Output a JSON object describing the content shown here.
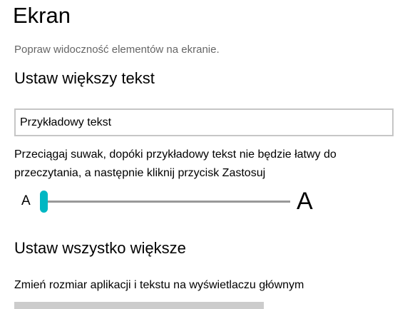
{
  "page": {
    "title": "Ekran",
    "subtitle": "Popraw widoczność elementów na ekranie."
  },
  "text_size": {
    "heading": "Ustaw większy tekst",
    "sample_value": "Przykładowy tekst",
    "description": "Przeciągaj suwak, dopóki przykładowy tekst nie będzie łatwy do przeczytania, a następnie kliknij przycisk Zastosuj",
    "small_label": "A",
    "large_label": "A",
    "slider_value_percent": 0,
    "accent": "#00b7c3"
  },
  "scale": {
    "heading": "Ustaw wszystko większe",
    "description": "Zmień rozmiar aplikacji i tekstu na wyświetlaczu głównym"
  }
}
